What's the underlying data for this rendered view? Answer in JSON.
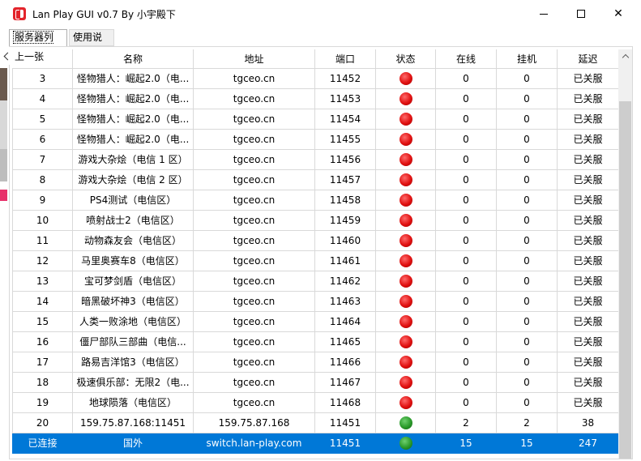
{
  "window": {
    "title": "Lan Play GUI v0.7 By 小宇殿下",
    "close_glyph": "✕"
  },
  "tabs": [
    {
      "label": "服务器列表",
      "active": true
    },
    {
      "label": "使用说明",
      "active": false
    }
  ],
  "overlay": {
    "prev_label": "上一张"
  },
  "table": {
    "columns": [
      "",
      "名称",
      "地址",
      "端口",
      "状态",
      "在线",
      "挂机",
      "延迟"
    ],
    "rows": [
      {
        "id": "3",
        "name": "怪物猎人：崛起2.0（电...",
        "address": "tgceo.cn",
        "port": "11452",
        "status": "red",
        "online": "0",
        "idle": "0",
        "latency": "已关服"
      },
      {
        "id": "4",
        "name": "怪物猎人：崛起2.0（电...",
        "address": "tgceo.cn",
        "port": "11453",
        "status": "red",
        "online": "0",
        "idle": "0",
        "latency": "已关服"
      },
      {
        "id": "5",
        "name": "怪物猎人：崛起2.0（电...",
        "address": "tgceo.cn",
        "port": "11454",
        "status": "red",
        "online": "0",
        "idle": "0",
        "latency": "已关服"
      },
      {
        "id": "6",
        "name": "怪物猎人：崛起2.0（电...",
        "address": "tgceo.cn",
        "port": "11455",
        "status": "red",
        "online": "0",
        "idle": "0",
        "latency": "已关服"
      },
      {
        "id": "7",
        "name": "游戏大杂烩（电信 1 区）",
        "address": "tgceo.cn",
        "port": "11456",
        "status": "red",
        "online": "0",
        "idle": "0",
        "latency": "已关服"
      },
      {
        "id": "8",
        "name": "游戏大杂烩（电信 2 区）",
        "address": "tgceo.cn",
        "port": "11457",
        "status": "red",
        "online": "0",
        "idle": "0",
        "latency": "已关服"
      },
      {
        "id": "9",
        "name": "PS4测试（电信区）",
        "address": "tgceo.cn",
        "port": "11458",
        "status": "red",
        "online": "0",
        "idle": "0",
        "latency": "已关服"
      },
      {
        "id": "10",
        "name": "喷射战士2（电信区）",
        "address": "tgceo.cn",
        "port": "11459",
        "status": "red",
        "online": "0",
        "idle": "0",
        "latency": "已关服"
      },
      {
        "id": "11",
        "name": "动物森友会（电信区）",
        "address": "tgceo.cn",
        "port": "11460",
        "status": "red",
        "online": "0",
        "idle": "0",
        "latency": "已关服"
      },
      {
        "id": "12",
        "name": "马里奥赛车8（电信区）",
        "address": "tgceo.cn",
        "port": "11461",
        "status": "red",
        "online": "0",
        "idle": "0",
        "latency": "已关服"
      },
      {
        "id": "13",
        "name": "宝可梦剑盾（电信区）",
        "address": "tgceo.cn",
        "port": "11462",
        "status": "red",
        "online": "0",
        "idle": "0",
        "latency": "已关服"
      },
      {
        "id": "14",
        "name": "暗黑破坏神3（电信区）",
        "address": "tgceo.cn",
        "port": "11463",
        "status": "red",
        "online": "0",
        "idle": "0",
        "latency": "已关服"
      },
      {
        "id": "15",
        "name": "人类一败涂地（电信区）",
        "address": "tgceo.cn",
        "port": "11464",
        "status": "red",
        "online": "0",
        "idle": "0",
        "latency": "已关服"
      },
      {
        "id": "16",
        "name": "僵尸部队三部曲（电信...",
        "address": "tgceo.cn",
        "port": "11465",
        "status": "red",
        "online": "0",
        "idle": "0",
        "latency": "已关服"
      },
      {
        "id": "17",
        "name": "路易吉洋馆3（电信区）",
        "address": "tgceo.cn",
        "port": "11466",
        "status": "red",
        "online": "0",
        "idle": "0",
        "latency": "已关服"
      },
      {
        "id": "18",
        "name": "极速俱乐部：无限2（电...",
        "address": "tgceo.cn",
        "port": "11467",
        "status": "red",
        "online": "0",
        "idle": "0",
        "latency": "已关服"
      },
      {
        "id": "19",
        "name": "地球陨落（电信区）",
        "address": "tgceo.cn",
        "port": "11468",
        "status": "red",
        "online": "0",
        "idle": "0",
        "latency": "已关服"
      },
      {
        "id": "20",
        "name": "159.75.87.168:11451",
        "address": "159.75.87.168",
        "port": "11451",
        "status": "green",
        "online": "2",
        "idle": "2",
        "latency": "38"
      },
      {
        "id": "已连接",
        "name": "国外",
        "address": "switch.lan-play.com",
        "port": "11451",
        "status": "green",
        "online": "15",
        "idle": "15",
        "latency": "247",
        "selected": true
      }
    ]
  },
  "colors": {
    "selection": "#0078d7",
    "status_red": "#e01010",
    "status_green": "#2a9a2a",
    "app_icon": "#e3242b"
  }
}
